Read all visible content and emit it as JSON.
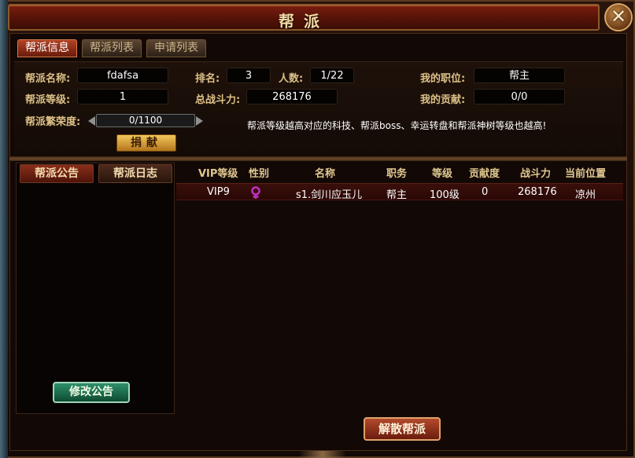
{
  "window": {
    "title": "帮派",
    "close_label": "✕"
  },
  "tabs": [
    {
      "label": "帮派信息",
      "active": true
    },
    {
      "label": "帮派列表",
      "active": false
    },
    {
      "label": "申请列表",
      "active": false
    }
  ],
  "info": {
    "guild_name_label": "帮派名称:",
    "guild_name": "fdafsa",
    "rank_label": "排名:",
    "rank": "3",
    "members_label": "人数:",
    "members": "1/22",
    "my_position_label": "我的职位:",
    "my_position": "帮主",
    "guild_level_label": "帮派等级:",
    "guild_level": "1",
    "total_power_label": "总战斗力:",
    "total_power": "268176",
    "my_contribution_label": "我的贡献:",
    "my_contribution": "0/0",
    "prosperity_label": "帮派繁荣度:",
    "prosperity": "0/1100",
    "tip": "帮派等级越高对应的科技、帮派boss、幸运转盘和帮派神树等级也越高!",
    "donate_label": "捐献"
  },
  "left_panel": {
    "tab_notice": "帮派公告",
    "tab_log": "帮派日志",
    "notice_text": "",
    "edit_label": "修改公告"
  },
  "table": {
    "headers": [
      "VIP等级",
      "性别",
      "名称",
      "职务",
      "等级",
      "贡献度",
      "战斗力",
      "当前位置"
    ],
    "rows": [
      {
        "vip": "VIP9",
        "gender_icon": "female-icon",
        "name": "s1.剑川应玉儿",
        "role": "帮主",
        "level": "100级",
        "contribution": "0",
        "power": "268176",
        "location": "凉州"
      }
    ]
  },
  "dissolve_label": "解散帮派",
  "colors": {
    "accent": "#b24225",
    "label": "#ddc188",
    "female": "#c22fc2"
  }
}
